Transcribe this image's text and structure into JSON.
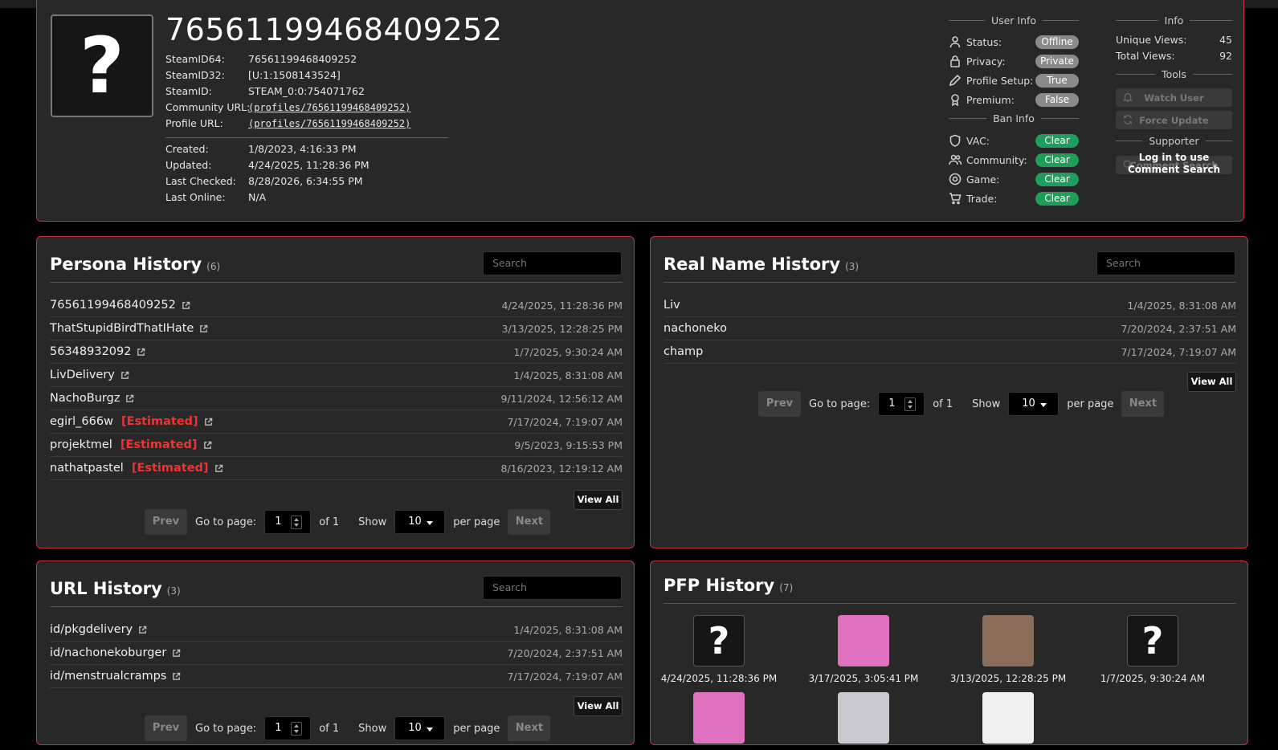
{
  "profile": {
    "steamid_title": "76561199468409252",
    "avatar_glyph": "?",
    "fields": [
      {
        "key": "SteamID64:",
        "value": "76561199468409252"
      },
      {
        "key": "SteamID32:",
        "value": "[U:1:1508143524]"
      },
      {
        "key": "SteamID:",
        "value": "STEAM_0:0:754071762"
      },
      {
        "key": "Community URL:",
        "value": "(profiles/76561199468409252)"
      },
      {
        "key": "Profile URL:",
        "value": "(profiles/76561199468409252)"
      }
    ],
    "dates": [
      {
        "key": "Created:",
        "value": "1/8/2023, 4:16:33 PM"
      },
      {
        "key": "Updated:",
        "value": "4/24/2025, 11:28:36 PM"
      },
      {
        "key": "Last Checked:",
        "value": "8/28/2026, 6:34:55 PM"
      },
      {
        "key": "Last Online:",
        "value": "N/A"
      }
    ]
  },
  "user_info": {
    "title": "User Info",
    "rows": [
      {
        "label": "Status:",
        "value": "Offline",
        "icon": "user-icon"
      },
      {
        "label": "Privacy:",
        "value": "Private",
        "icon": "lock-icon"
      },
      {
        "label": "Profile Setup:",
        "value": "True",
        "icon": "pencil-icon"
      },
      {
        "label": "Premium:",
        "value": "False",
        "icon": "award-icon"
      }
    ]
  },
  "ban_info": {
    "title": "Ban Info",
    "rows": [
      {
        "label": "VAC:",
        "value": "Clear",
        "icon": "shield-icon"
      },
      {
        "label": "Community:",
        "value": "Clear",
        "icon": "users-icon"
      },
      {
        "label": "Game:",
        "value": "Clear",
        "icon": "target-icon"
      },
      {
        "label": "Trade:",
        "value": "Clear",
        "icon": "cart-icon"
      }
    ]
  },
  "info": {
    "title": "Info",
    "unique_views_label": "Unique Views:",
    "unique_views": "45",
    "total_views_label": "Total Views:",
    "total_views": "92"
  },
  "tools": {
    "title": "Tools",
    "watch_user": "Watch User",
    "force_update": "Force Update",
    "supporter_title": "Supporter",
    "comment_search": "Comment Search",
    "login_message": "Log in to use Comment Search"
  },
  "persona": {
    "title": "Persona History",
    "count": "(6)",
    "search_placeholder": "Search",
    "rows": [
      {
        "name": "76561199468409252",
        "estimated": "",
        "date": "4/24/2025, 11:28:36 PM"
      },
      {
        "name": "ThatStupidBirdThatIHate",
        "estimated": "",
        "date": "3/13/2025, 12:28:25 PM"
      },
      {
        "name": "56348932092",
        "estimated": "",
        "date": "1/7/2025, 9:30:24 AM"
      },
      {
        "name": "LivDelivery",
        "estimated": "",
        "date": "1/4/2025, 8:31:08 AM"
      },
      {
        "name": "NachoBurgz",
        "estimated": "",
        "date": "9/11/2024, 12:56:12 AM"
      },
      {
        "name": "egirl_666w",
        "estimated": "[Estimated]",
        "date": "7/17/2024, 7:19:07 AM"
      },
      {
        "name": "projektmel",
        "estimated": "[Estimated]",
        "date": "9/5/2023, 9:15:53 PM"
      },
      {
        "name": "nathatpastel",
        "estimated": "[Estimated]",
        "date": "8/16/2023, 12:19:12 AM"
      }
    ],
    "view_all": "View All"
  },
  "realname": {
    "title": "Real Name History",
    "count": "(3)",
    "search_placeholder": "Search",
    "rows": [
      {
        "name": "Liv",
        "date": "1/4/2025, 8:31:08 AM"
      },
      {
        "name": "nachoneko",
        "date": "7/20/2024, 2:37:51 AM"
      },
      {
        "name": "champ",
        "date": "7/17/2024, 7:19:07 AM"
      }
    ],
    "view_all": "View All"
  },
  "url": {
    "title": "URL History",
    "count": "(3)",
    "search_placeholder": "Search",
    "rows": [
      {
        "name": "id/pkgdelivery",
        "date": "1/4/2025, 8:31:08 AM"
      },
      {
        "name": "id/nachonekoburger",
        "date": "7/20/2024, 2:37:51 AM"
      },
      {
        "name": "id/menstrualcramps",
        "date": "7/17/2024, 7:19:07 AM"
      }
    ],
    "view_all": "View All"
  },
  "pfp": {
    "title": "PFP History",
    "count": "(7)",
    "items": [
      {
        "caption": "4/24/2025, 11:28:36 PM",
        "placeholder": "?",
        "color": "#161616"
      },
      {
        "caption": "3/17/2025, 3:05:41 PM",
        "placeholder": "",
        "color": "#e070c0"
      },
      {
        "caption": "3/13/2025, 12:28:25 PM",
        "placeholder": "",
        "color": "#8a6e5a"
      },
      {
        "caption": "1/7/2025, 9:30:24 AM",
        "placeholder": "?",
        "color": "#161616"
      },
      {
        "caption": "",
        "placeholder": "",
        "color": "#e070c0"
      },
      {
        "caption": "",
        "placeholder": "",
        "color": "#c8c8d0"
      },
      {
        "caption": "",
        "placeholder": "",
        "color": "#f0f0f0"
      }
    ]
  },
  "pager": {
    "prev": "Prev",
    "next": "Next",
    "goto_label": "Go to page:",
    "page": "1",
    "of_label": "of 1",
    "show_label": "Show",
    "per_page_value": "10",
    "per_page_label": "per page"
  },
  "colors": {
    "accent_border": "#c0363c",
    "estimated": "#e33333",
    "clear": "#1f9d5b",
    "neutral_pill": "#8a8a8a"
  }
}
